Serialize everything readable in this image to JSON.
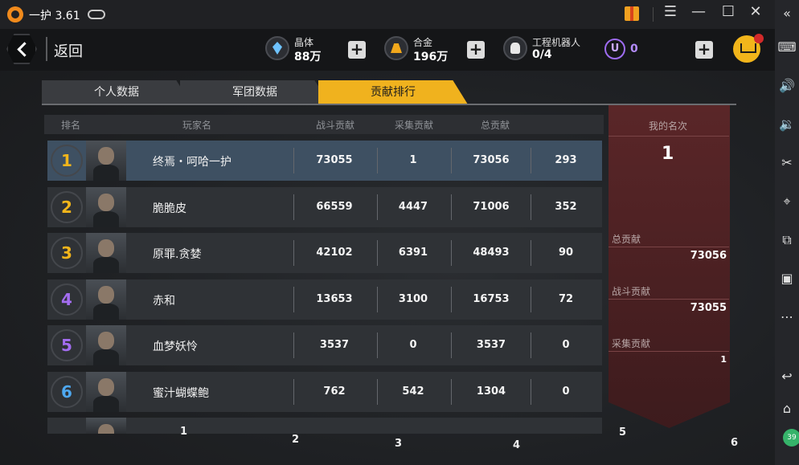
{
  "window": {
    "title": "一护 3.61",
    "controls": {
      "menu": "☰",
      "minimize": "—",
      "maximize": "☐",
      "close": "✕",
      "collapse": "«"
    }
  },
  "sidebar": {
    "items": [
      {
        "icon": "keyboard-icon",
        "glyph": "⌨"
      },
      {
        "icon": "volume-up-icon",
        "glyph": "🔊"
      },
      {
        "icon": "volume-down-icon",
        "glyph": "🔉"
      },
      {
        "icon": "scissors-icon",
        "glyph": "✂"
      },
      {
        "icon": "location-icon",
        "glyph": "⌖"
      },
      {
        "icon": "add-window-icon",
        "glyph": "⧉"
      },
      {
        "icon": "apk-icon",
        "glyph": "▣"
      },
      {
        "icon": "more-icon",
        "glyph": "⋯"
      },
      {
        "icon": "back-icon",
        "glyph": "↩"
      },
      {
        "icon": "home-icon",
        "glyph": "⌂"
      }
    ],
    "badge": "39"
  },
  "topbar": {
    "back_label": "返回",
    "crystal": {
      "label": "晶体",
      "value": "88万"
    },
    "alloy": {
      "label": "合金",
      "value": "196万"
    },
    "robot": {
      "label": "工程机器人",
      "value": "0/4"
    },
    "u_coin": {
      "symbol": "U",
      "value": "0"
    },
    "plus": "+"
  },
  "tabs": [
    {
      "label": "个人数据",
      "active": false
    },
    {
      "label": "军团数据",
      "active": false
    },
    {
      "label": "贡献排行",
      "active": true
    }
  ],
  "table": {
    "headers": {
      "rank": "排名",
      "player": "玩家名",
      "battle": "战斗贡献",
      "gather": "采集贡献",
      "total": "总贡献"
    },
    "rows": [
      {
        "rank": "1",
        "name": "终焉・呵哈一护",
        "battle": "73055",
        "gather": "1",
        "total": "73056",
        "extra": "293",
        "rank_color": "#f2b51b",
        "highlight": true
      },
      {
        "rank": "2",
        "name": "脆脆皮",
        "battle": "66559",
        "gather": "4447",
        "total": "71006",
        "extra": "352",
        "rank_color": "#f2b51b",
        "highlight": false
      },
      {
        "rank": "3",
        "name": "原罪.贪婪",
        "battle": "42102",
        "gather": "6391",
        "total": "48493",
        "extra": "90",
        "rank_color": "#f2b51b",
        "highlight": false
      },
      {
        "rank": "4",
        "name": "赤和",
        "battle": "13653",
        "gather": "3100",
        "total": "16753",
        "extra": "72",
        "rank_color": "#a36df0",
        "highlight": false
      },
      {
        "rank": "5",
        "name": "血梦妖怜",
        "battle": "3537",
        "gather": "0",
        "total": "3537",
        "extra": "0",
        "rank_color": "#a36df0",
        "highlight": false
      },
      {
        "rank": "6",
        "name": "蜜汁蝴蝶鲍",
        "battle": "762",
        "gather": "542",
        "total": "1304",
        "extra": "0",
        "rank_color": "#4ea8f0",
        "highlight": false
      }
    ]
  },
  "my_rank": {
    "title": "我的名次",
    "rank": "1",
    "total_label": "总贡献",
    "total_value": "73056",
    "battle_label": "战斗贡献",
    "battle_value": "73055",
    "gather_label": "采集贡献",
    "gather_value": "1"
  },
  "column_numbers": [
    "1",
    "2",
    "3",
    "4",
    "5",
    "6"
  ]
}
